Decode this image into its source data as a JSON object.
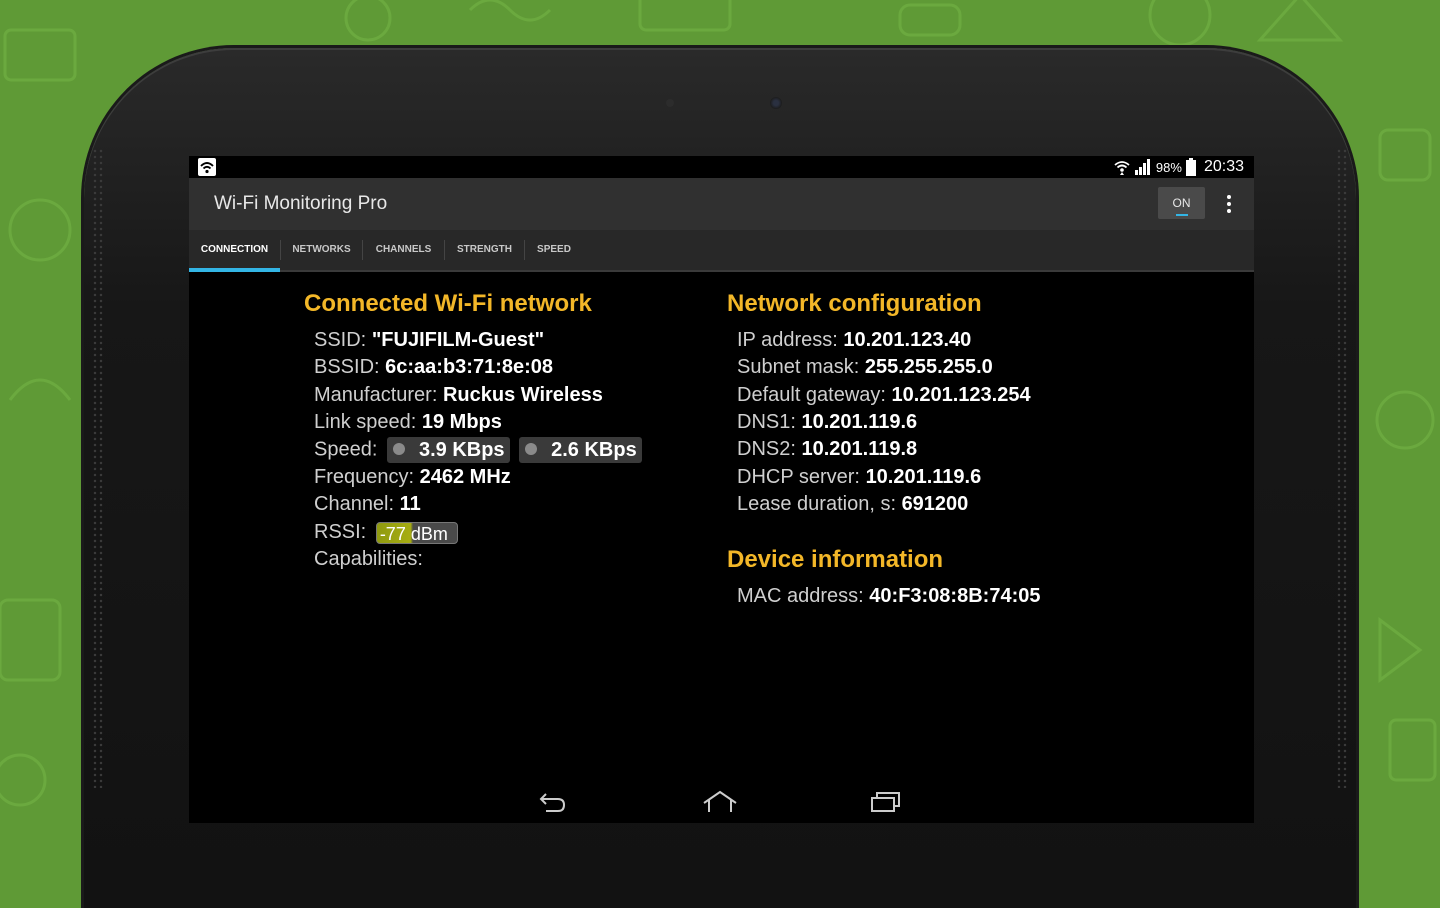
{
  "status_bar": {
    "battery": "98%",
    "time": "20:33"
  },
  "app_bar": {
    "title": "Wi-Fi Monitoring Pro",
    "toggle_label": "ON"
  },
  "tabs": [
    {
      "label": "CONNECTION"
    },
    {
      "label": "NETWORKS"
    },
    {
      "label": "CHANNELS"
    },
    {
      "label": "STRENGTH"
    },
    {
      "label": "SPEED"
    }
  ],
  "connected": {
    "title": "Connected Wi-Fi network",
    "ssid_label": "SSID:",
    "ssid": "\"FUJIFILM-Guest\"",
    "bssid_label": "BSSID:",
    "bssid": "6c:aa:b3:71:8e:08",
    "manufacturer_label": "Manufacturer:",
    "manufacturer": "Ruckus Wireless",
    "link_speed_label": "Link speed:",
    "link_speed": "19 Mbps",
    "speed_label": "Speed:",
    "speed_down": "3.9 KBps",
    "speed_up": "2.6 KBps",
    "frequency_label": "Frequency:",
    "frequency": "2462 MHz",
    "channel_label": "Channel:",
    "channel": "11",
    "rssi_label": "RSSI:",
    "rssi": "-77 dBm",
    "rssi_level": 0.45,
    "capabilities_label": "Capabilities:"
  },
  "network_config": {
    "title": "Network configuration",
    "ip_label": "IP address:",
    "ip": "10.201.123.40",
    "subnet_label": "Subnet mask:",
    "subnet": "255.255.255.0",
    "gateway_label": "Default gateway:",
    "gateway": "10.201.123.254",
    "dns1_label": "DNS1:",
    "dns1": "10.201.119.6",
    "dns2_label": "DNS2:",
    "dns2": "10.201.119.8",
    "dhcp_label": "DHCP server:",
    "dhcp": "10.201.119.6",
    "lease_label": "Lease duration, s:",
    "lease": "691200"
  },
  "device_info": {
    "title": "Device information",
    "mac_label": "MAC address:",
    "mac": "40:F3:08:8B:74:05"
  },
  "colors": {
    "accent": "#33b5e5",
    "section_title": "#f3b728",
    "background": "#5f9a36"
  },
  "icons": [
    "wifi-notification-icon",
    "wifi-signal-icon",
    "cell-signal-icon",
    "battery-icon",
    "overflow-menu-icon",
    "download-arrow-icon",
    "upload-arrow-icon",
    "back-icon",
    "home-icon",
    "recents-icon"
  ]
}
